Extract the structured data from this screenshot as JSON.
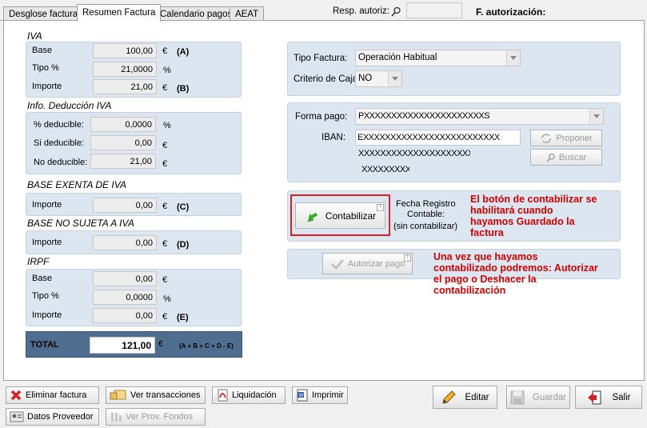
{
  "tabs": [
    {
      "label": "Desglose factura"
    },
    {
      "label": "Resumen Factura"
    },
    {
      "label": "Calendario pagos"
    },
    {
      "label": "AEAT"
    }
  ],
  "header": {
    "resp_label": "Resp. autoriz:",
    "resp_value": "",
    "fauto_label": "F. autorización:"
  },
  "iva": {
    "title": "IVA",
    "base_label": "Base",
    "base_value": "100,00",
    "base_unit": "€",
    "base_letter": "(A)",
    "tipo_label": "Tipo %",
    "tipo_value": "21,0000",
    "tipo_unit": "%",
    "importe_label": "Importe",
    "importe_value": "21,00",
    "importe_unit": "€",
    "importe_letter": "(B)"
  },
  "deduccion": {
    "title": "Info. Deducción IVA",
    "pct_label": "% deducible:",
    "pct_value": "0,0000",
    "pct_unit": "%",
    "si_label": "Si deducible:",
    "si_value": "0,00",
    "si_unit": "€",
    "no_label": "No deducible:",
    "no_value": "21,00",
    "no_unit": "€"
  },
  "exenta": {
    "title": "BASE EXENTA DE IVA",
    "importe_label": "Importe",
    "importe_value": "0,00",
    "unit": "€",
    "letter": "(C)"
  },
  "no_sujeta": {
    "title": "BASE NO SUJETA A IVA",
    "importe_label": "Importe",
    "importe_value": "0,00",
    "unit": "€",
    "letter": "(D)"
  },
  "irpf": {
    "title": "IRPF",
    "base_label": "Base",
    "base_value": "0,00",
    "base_unit": "€",
    "tipo_label": "Tipo %",
    "tipo_value": "0,0000",
    "tipo_unit": "%",
    "importe_label": "Importe",
    "importe_value": "0,00",
    "importe_unit": "€",
    "importe_letter": "(E)"
  },
  "total": {
    "label": "TOTAL",
    "value": "121,00",
    "unit": "€",
    "formula": "(A + B + C + D - E)"
  },
  "factura": {
    "tipo_label": "Tipo Factura:",
    "tipo_value": "Operación Habitual",
    "criterio_label": "Criterio de Caja:",
    "criterio_value": "NO"
  },
  "pago": {
    "forma_label": "Forma pago:",
    "forma_value": "PXXXXXXXXXXXXXXXXXXXXXXS",
    "iban_label": "IBAN:",
    "iban_value": "EXXXXXXXXXXXXXXXXXXXXXXXXX",
    "line2": "XXXXXXXXXXXXXXXXXXXXXXX",
    "line3": "XXXXXXXXX",
    "proponer_label": "Proponer",
    "buscar_label": "Buscar"
  },
  "contabilizar": {
    "button_label": "Contabilizar",
    "fecha_line1": "Fecha Registro",
    "fecha_line2": "Contable:",
    "fecha_line3": "(sin contabilizar)",
    "note": [
      "El botón de contabilizar se",
      "habilitará cuando",
      "hayamos Guardado la",
      "factura"
    ]
  },
  "autorizar": {
    "button_label": "Autorizar pago",
    "note": [
      "Una vez que hayamos",
      "contabilizado podremos: Autorizar",
      "el pago o Deshacer la",
      "contabilización"
    ]
  },
  "bottom": {
    "eliminar": "Eliminar factura",
    "ver_transacciones": "Ver transacciones",
    "liquidacion": "Liquidación",
    "imprimir": "Imprimir",
    "datos_proveedor": "Datos Proveedor",
    "ver_prov_fondos": "Ver Prov. Fondos",
    "editar": "Editar",
    "guardar": "Guardar",
    "salir": "Salir"
  },
  "colors": {
    "panel": "#dce6f1",
    "total_panel": "#4f6d8f",
    "highlight_red": "#e02020",
    "note_red": "#d00000"
  }
}
